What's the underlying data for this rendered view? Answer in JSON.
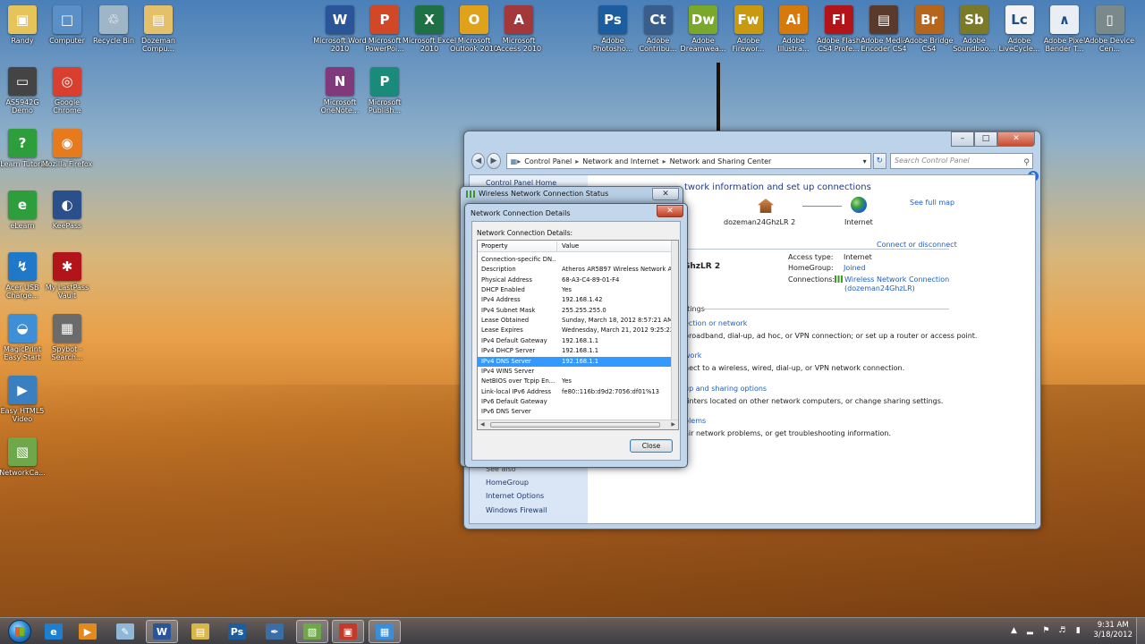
{
  "desktop": {
    "icons_left": [
      {
        "label": "Randy",
        "glyph": "folder-user-icon",
        "color": "#e7c45a",
        "ch": "▣"
      },
      {
        "label": "Computer",
        "glyph": "computer-icon",
        "color": "#5b8fc7",
        "ch": "□"
      },
      {
        "label": "Recycle Bin",
        "glyph": "recycle-bin-icon",
        "color": "#9fb6c8",
        "ch": "♲"
      },
      {
        "label": "Dozeman Compu...",
        "glyph": "folder-icon",
        "color": "#e4c06a",
        "ch": "▤"
      },
      {
        "label": "AS5942G Demo",
        "glyph": "laptop-icon",
        "color": "#444",
        "ch": "▭"
      },
      {
        "label": "Google Chrome",
        "glyph": "chrome-icon",
        "color": "#d93f2f",
        "ch": "◎"
      },
      {
        "label": "eLearn Tutorial",
        "glyph": "elearn-tutorial-icon",
        "color": "#2e9e3c",
        "ch": "?"
      },
      {
        "label": "Mozilla Firefox",
        "glyph": "firefox-icon",
        "color": "#e87a1e",
        "ch": "◉"
      },
      {
        "label": "eLearn",
        "glyph": "elearn-icon",
        "color": "#2e9e3c",
        "ch": "e"
      },
      {
        "label": "KeePass",
        "glyph": "keepass-icon",
        "color": "#2a4f8a",
        "ch": "◐"
      },
      {
        "label": "Acer USB Charge...",
        "glyph": "usb-charge-icon",
        "color": "#1f78c8",
        "ch": "↯"
      },
      {
        "label": "My LastPass Vault",
        "glyph": "lastpass-icon",
        "color": "#b1151b",
        "ch": "✱"
      },
      {
        "label": "MagicPrint Easy Start",
        "glyph": "magicprint-icon",
        "color": "#3e8fd6",
        "ch": "◒"
      },
      {
        "label": "Spybot - Search...",
        "glyph": "spybot-icon",
        "color": "#6b6b6b",
        "ch": "▦"
      },
      {
        "label": "Easy HTML5 Video",
        "glyph": "html5-video-icon",
        "color": "#3a7fbf",
        "ch": "▶"
      },
      {
        "label": "NetworkCa...",
        "glyph": "network-capture-icon",
        "color": "#6ea84a",
        "ch": "▧"
      }
    ],
    "icons_office": [
      {
        "label": "Microsoft Word 2010",
        "glyph": "word-icon",
        "color": "#2a5699",
        "ch": "W"
      },
      {
        "label": "Microsoft PowerPoi...",
        "glyph": "powerpoint-icon",
        "color": "#d24726",
        "ch": "P"
      },
      {
        "label": "Microsoft Excel 2010",
        "glyph": "excel-icon",
        "color": "#1e7145",
        "ch": "X"
      },
      {
        "label": "Microsoft Outlook 2010",
        "glyph": "outlook-icon",
        "color": "#e0a21a",
        "ch": "O"
      },
      {
        "label": "Microsoft Access 2010",
        "glyph": "access-icon",
        "color": "#a4373a",
        "ch": "A"
      },
      {
        "label": "Microsoft OneNote...",
        "glyph": "onenote-icon",
        "color": "#80397b",
        "ch": "N"
      },
      {
        "label": "Microsoft Publish...",
        "glyph": "publisher-icon",
        "color": "#1a8a7b",
        "ch": "P"
      }
    ],
    "icons_adobe": [
      {
        "label": "Adobe Photosho...",
        "glyph": "photoshop-icon",
        "color": "#1b5d9e",
        "ch": "Ps"
      },
      {
        "label": "Adobe Contribu...",
        "glyph": "contribute-icon",
        "color": "#3a5e8c",
        "ch": "Ct"
      },
      {
        "label": "Adobe Dreamwea...",
        "glyph": "dreamweaver-icon",
        "color": "#7aa82a",
        "ch": "Dw"
      },
      {
        "label": "Adobe Firewor...",
        "glyph": "fireworks-icon",
        "color": "#c99a10",
        "ch": "Fw"
      },
      {
        "label": "Adobe Illustra...",
        "glyph": "illustrator-icon",
        "color": "#d67a0c",
        "ch": "Ai"
      },
      {
        "label": "Adobe Flash CS4 Profe...",
        "glyph": "flash-icon",
        "color": "#b3141a",
        "ch": "Fl"
      },
      {
        "label": "Adobe Media Encoder CS4",
        "glyph": "media-encoder-icon",
        "color": "#5a3a2a",
        "ch": "▤"
      },
      {
        "label": "Adobe Bridge CS4",
        "glyph": "bridge-icon",
        "color": "#b5661c",
        "ch": "Br"
      },
      {
        "label": "Adobe Soundboo...",
        "glyph": "soundbooth-icon",
        "color": "#7b7a26",
        "ch": "Sb"
      },
      {
        "label": "Adobe LiveCycle...",
        "glyph": "livecycle-icon",
        "color": "#f4f4f4",
        "ch": "Lc"
      },
      {
        "label": "Adobe Pixel Bender T...",
        "glyph": "pixel-bender-icon",
        "color": "#e8eef4",
        "ch": "∧"
      },
      {
        "label": "Adobe Device Cen...",
        "glyph": "device-central-icon",
        "color": "#7a8a8a",
        "ch": "▯"
      }
    ]
  },
  "control_panel": {
    "address": [
      "Control Panel",
      "Network and Internet",
      "Network and Sharing Center"
    ],
    "search_placeholder": "Search Control Panel",
    "sidebar": [
      "Control Panel Home",
      "See also",
      "HomeGroup",
      "Internet Options",
      "Windows Firewall"
    ],
    "heading": "View your basic network information and set up connections",
    "heading_visible": "twork information and set up connections",
    "see_full_map": "See full map",
    "map_nodes": [
      "dozeman24GhzLR  2",
      "Internet"
    ],
    "connect_or_disconnect": "Connect or disconnect",
    "network_name_partial": "GhzLR  2",
    "network_type_partial": "k",
    "access_type_label": "Access type:",
    "access_type_value": "Internet",
    "homegroup_label": "HomeGroup:",
    "homegroup_value": "Joined",
    "connections_label": "Connections:",
    "connections_value": "Wireless Network Connection",
    "connections_value2": "(dozeman24GhzLR)",
    "change_settings_partial": "ttings",
    "tasks": [
      {
        "link": "ection or network",
        "desc": "broadband, dial-up, ad hoc, or VPN connection; or set up a router or access point."
      },
      {
        "link": "work",
        "desc": "nect to a wireless, wired, dial-up, or VPN network connection."
      },
      {
        "link": "up and sharing options",
        "desc": "rinters located on other network computers, or change sharing settings."
      },
      {
        "link": "blems",
        "desc": "air network problems, or get troubleshooting information."
      }
    ]
  },
  "status_window": {
    "title": "Wireless Network Connection Status"
  },
  "details_dialog": {
    "title": "Network Connection Details",
    "section_label": "Network Connection Details:",
    "col_property": "Property",
    "col_value": "Value",
    "rows": [
      {
        "p": "Connection-specific DN...",
        "v": ""
      },
      {
        "p": "Description",
        "v": "Atheros AR5B97 Wireless Network Adapt"
      },
      {
        "p": "Physical Address",
        "v": "68-A3-C4-89-01-F4"
      },
      {
        "p": "DHCP Enabled",
        "v": "Yes"
      },
      {
        "p": "IPv4 Address",
        "v": "192.168.1.42"
      },
      {
        "p": "IPv4 Subnet Mask",
        "v": "255.255.255.0"
      },
      {
        "p": "Lease Obtained",
        "v": "Sunday, March 18, 2012 8:57:21 AM"
      },
      {
        "p": "Lease Expires",
        "v": "Wednesday, March 21, 2012 9:25:22 AM"
      },
      {
        "p": "IPv4 Default Gateway",
        "v": "192.168.1.1"
      },
      {
        "p": "IPv4 DHCP Server",
        "v": "192.168.1.1"
      },
      {
        "p": "IPv4 DNS Server",
        "v": "192.168.1.1"
      },
      {
        "p": "IPv4 WINS Server",
        "v": ""
      },
      {
        "p": "NetBIOS over Tcpip En...",
        "v": "Yes"
      },
      {
        "p": "Link-local IPv6 Address",
        "v": "fe80::116b:d9d2:7056:df01%13"
      },
      {
        "p": "IPv6 Default Gateway",
        "v": ""
      },
      {
        "p": "IPv6 DNS Server",
        "v": ""
      }
    ],
    "selected_index": 10,
    "close_label": "Close"
  },
  "taskbar": {
    "items": [
      {
        "name": "taskbar-ie-icon",
        "ch": "e",
        "color": "#1e7fd0",
        "active": false
      },
      {
        "name": "taskbar-media-player-icon",
        "ch": "▶",
        "color": "#e38a1c",
        "active": false
      },
      {
        "name": "taskbar-notepad-icon",
        "ch": "✎",
        "color": "#8fb8d8",
        "active": false
      },
      {
        "name": "taskbar-word-icon",
        "ch": "W",
        "color": "#2a5699",
        "active": true
      },
      {
        "name": "taskbar-explorer-icon",
        "ch": "▤",
        "color": "#d8b64a",
        "active": false
      },
      {
        "name": "taskbar-photoshop-icon",
        "ch": "Ps",
        "color": "#1b5d9e",
        "active": false
      },
      {
        "name": "taskbar-pen-tool-icon",
        "ch": "✒",
        "color": "#3a6ea5",
        "active": false
      },
      {
        "name": "taskbar-network-app-icon",
        "ch": "▧",
        "color": "#6ea84a",
        "active": true
      },
      {
        "name": "taskbar-screen-capture-icon",
        "ch": "▣",
        "color": "#c23a2a",
        "active": true
      },
      {
        "name": "taskbar-control-panel-icon",
        "ch": "▦",
        "color": "#3a8ed8",
        "active": true
      }
    ],
    "time": "9:31 AM",
    "date": "3/18/2012"
  }
}
